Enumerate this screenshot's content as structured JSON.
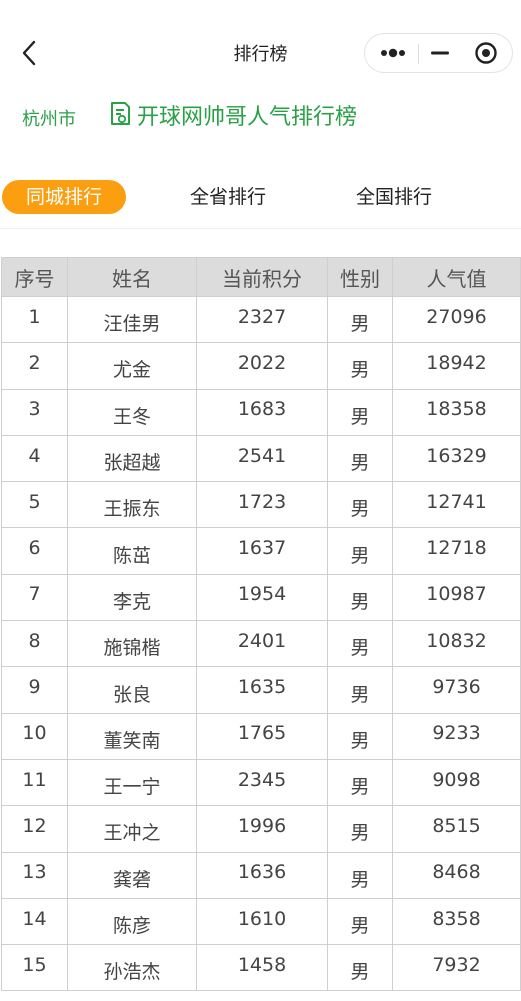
{
  "nav": {
    "title": "排行榜"
  },
  "header": {
    "city": "杭州市",
    "board_title": "开球网帅哥人气排行榜"
  },
  "tabs": [
    {
      "label": "同城排行",
      "active": true
    },
    {
      "label": "全省排行",
      "active": false
    },
    {
      "label": "全国排行",
      "active": false
    }
  ],
  "table": {
    "columns": [
      "序号",
      "姓名",
      "当前积分",
      "性别",
      "人气值"
    ],
    "rows": [
      {
        "rank": "1",
        "name": "汪佳男",
        "score": "2327",
        "gender": "男",
        "popularity": "27096"
      },
      {
        "rank": "2",
        "name": "尤金",
        "score": "2022",
        "gender": "男",
        "popularity": "18942"
      },
      {
        "rank": "3",
        "name": "王冬",
        "score": "1683",
        "gender": "男",
        "popularity": "18358"
      },
      {
        "rank": "4",
        "name": "张超越",
        "score": "2541",
        "gender": "男",
        "popularity": "16329"
      },
      {
        "rank": "5",
        "name": "王振东",
        "score": "1723",
        "gender": "男",
        "popularity": "12741"
      },
      {
        "rank": "6",
        "name": "陈茁",
        "score": "1637",
        "gender": "男",
        "popularity": "12718"
      },
      {
        "rank": "7",
        "name": "李克",
        "score": "1954",
        "gender": "男",
        "popularity": "10987"
      },
      {
        "rank": "8",
        "name": "施锦楷",
        "score": "2401",
        "gender": "男",
        "popularity": "10832"
      },
      {
        "rank": "9",
        "name": "张良",
        "score": "1635",
        "gender": "男",
        "popularity": "9736"
      },
      {
        "rank": "10",
        "name": "董笑南",
        "score": "1765",
        "gender": "男",
        "popularity": "9233"
      },
      {
        "rank": "11",
        "name": "王一宁",
        "score": "2345",
        "gender": "男",
        "popularity": "9098"
      },
      {
        "rank": "12",
        "name": "王冲之",
        "score": "1996",
        "gender": "男",
        "popularity": "8515"
      },
      {
        "rank": "13",
        "name": "龚砻",
        "score": "1636",
        "gender": "男",
        "popularity": "8468"
      },
      {
        "rank": "14",
        "name": "陈彦",
        "score": "1610",
        "gender": "男",
        "popularity": "8358"
      },
      {
        "rank": "15",
        "name": "孙浩杰",
        "score": "1458",
        "gender": "男",
        "popularity": "7932"
      }
    ]
  },
  "colors": {
    "accent": "#fb9e0f",
    "green": "#2aa147",
    "header_bg": "#dcdcdc"
  }
}
